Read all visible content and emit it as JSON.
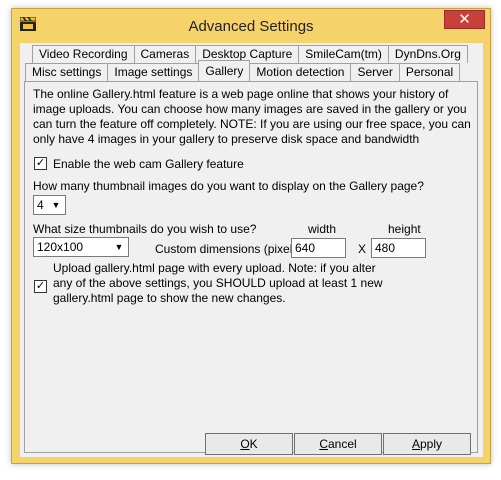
{
  "window": {
    "title": "Advanced Settings",
    "close_glyph": "✕"
  },
  "tabs": {
    "row1": [
      "Video Recording",
      "Cameras",
      "Desktop Capture",
      "SmileCam(tm)",
      "DynDns.Org"
    ],
    "row2": [
      "Misc settings",
      "Image settings",
      "Gallery",
      "Motion detection",
      "Server",
      "Personal"
    ],
    "active": "Gallery"
  },
  "gallery": {
    "description": "The online Gallery.html feature is a web page online that shows your history of image uploads. You can choose how many images are saved in the gallery or you can turn the feature off completely. NOTE: If you are using our free space, you can only have 4 images in your gallery to preserve disk space and bandwidth",
    "enable_label": "Enable the web cam Gallery feature",
    "enable_checked": true,
    "thumb_count_question": "How many thumbnail images do you want to display on the Gallery page?",
    "thumb_count_value": "4",
    "thumb_size_question": "What size thumbnails do you wish to use?",
    "thumb_size_value": "120x100",
    "custom_dim_label": "Custom dimensions (pixels)",
    "width_label": "width",
    "height_label": "height",
    "width_value": "640",
    "x_label": "X",
    "height_value": "480",
    "upload_label": "Upload gallery.html page with every upload. Note: if you alter any of the above settings, you SHOULD upload at least 1 new gallery.html page to show the new changes.",
    "upload_checked": true
  },
  "buttons": {
    "ok_mn": "O",
    "ok_rest": "K",
    "cancel_first": "",
    "cancel_mn": "C",
    "cancel_rest": "ancel",
    "apply_mn": "A",
    "apply_rest": "pply"
  },
  "colors": {
    "titlebar": "#f6d26b",
    "close": "#c7403a",
    "client": "#f0f0f0"
  }
}
